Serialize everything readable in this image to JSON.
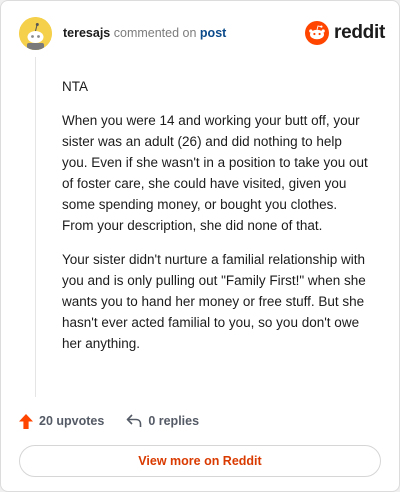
{
  "header": {
    "username": "teresajs",
    "action_text": "commented on",
    "post_link": "post",
    "brand": "reddit"
  },
  "comment": {
    "paragraphs": [
      "NTA",
      "When you were 14 and working your butt off, your sister was an adult (26) and did nothing to help you. Even if she wasn't in a position to take you out of foster care, she could have visited, given you some spending money, or bought you clothes. From your description, she did none of that.",
      "Your sister didn't nurture a familial relationship with you and is only pulling out \"Family First!\" when she wants you to hand her money or free stuff. But she hasn't ever acted familial to you, so you don't owe her anything."
    ]
  },
  "actions": {
    "upvotes_label": "20 upvotes",
    "replies_label": "0 replies"
  },
  "footer": {
    "view_more_label": "View more on Reddit"
  },
  "colors": {
    "brand_orange": "#ff4500",
    "link_blue": "#0b4a8a",
    "cta_text": "#d93a00"
  }
}
